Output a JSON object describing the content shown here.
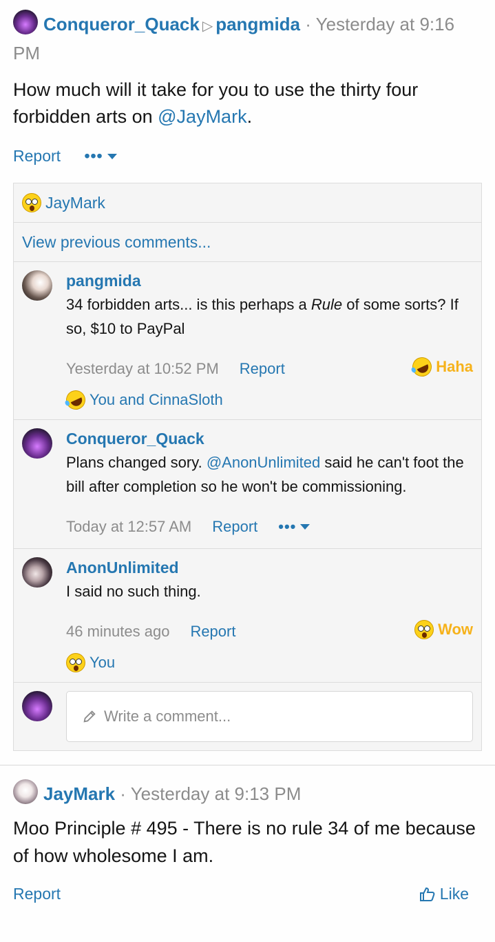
{
  "post1": {
    "author": "Conqueror_Quack",
    "recipient": "pangmida",
    "timestamp": "Yesterday at 9:16 PM",
    "body_prefix": "How much will it take for you to use the thirty four forbidden arts on ",
    "body_mention": "@JayMark",
    "body_suffix": ".",
    "report_label": "Report",
    "more_label": "•••"
  },
  "comments": {
    "reaction_summary": "JayMark",
    "view_previous": "View previous comments...",
    "items": [
      {
        "author": "pangmida",
        "text_a": "34 forbidden arts... is this perhaps a ",
        "text_em": "Rule",
        "text_b": " of some sorts? If so, $10 to PayPal",
        "time": "Yesterday at 10:52 PM",
        "report": "Report",
        "reaction_label": "Haha",
        "reacted_by": "You and CinnaSloth"
      },
      {
        "author": "Conqueror_Quack",
        "text_a": "Plans changed sory. ",
        "mention": "@AnonUnlimited",
        "text_b": " said he can't foot the bill after completion so he won't be commissioning.",
        "time": "Today at 12:57 AM",
        "report": "Report",
        "more_label": "•••"
      },
      {
        "author": "AnonUnlimited",
        "text": "I said no such thing.",
        "time": "46 minutes ago",
        "report": "Report",
        "reaction_label": "Wow",
        "reacted_by": "You"
      }
    ],
    "write_placeholder": "Write a comment..."
  },
  "post2": {
    "author": "JayMark",
    "timestamp": "Yesterday at 9:13 PM",
    "body": "Moo Principle # 495 - There is no rule 34 of me because of how wholesome I am.",
    "report_label": "Report",
    "like_label": "Like"
  },
  "colors": {
    "link": "#2577b1",
    "meta": "#8c8c8c",
    "reaction": "#f6b21b",
    "panel": "#f5f5f5"
  }
}
